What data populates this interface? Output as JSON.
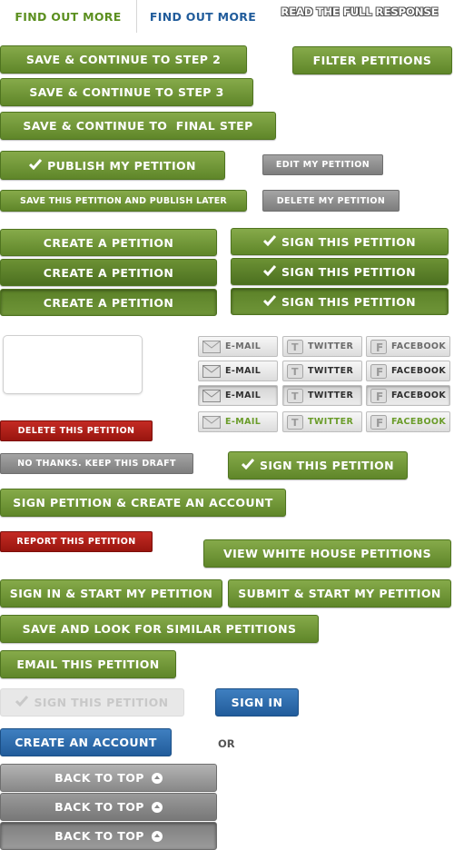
{
  "tabs": {
    "find_out_more_green": "FIND OUT MORE",
    "find_out_more_blue": "FIND OUT MORE",
    "read_full_response": "READ THE FULL RESPONSE"
  },
  "buttons": {
    "save_step2": "SAVE & CONTINUE TO STEP 2",
    "filter_petitions": "FILTER PETITIONS",
    "save_step3": "SAVE & CONTINUE TO STEP 3",
    "save_final": "SAVE & CONTINUE TO  FINAL STEP",
    "publish": "PUBLISH MY PETITION",
    "edit_petition": "EDIT MY PETITION",
    "save_publish_later": "SAVE THIS PETITION AND PUBLISH LATER",
    "delete_my_petition": "DELETE MY PETITION",
    "create_petition": "CREATE A PETITION",
    "sign_petition": "SIGN THIS PETITION",
    "delete_this_petition": "DELETE THIS PETITION",
    "no_thanks_draft": "NO THANKS. KEEP THIS DRAFT",
    "sign_and_create_account": "SIGN PETITION & CREATE AN ACCOUNT",
    "report_petition": "REPORT THIS PETITION",
    "view_white_house": "VIEW WHITE HOUSE PETITIONS",
    "sign_in_start": "SIGN IN & START MY PETITION",
    "submit_start": "SUBMIT & START MY PETITION",
    "save_look_similar": "SAVE AND LOOK FOR SIMILAR PETITIONS",
    "email_petition": "EMAIL THIS PETITION",
    "sign_disabled": "SIGN THIS PETITION",
    "sign_in": "SIGN IN",
    "create_account": "CREATE AN ACCOUNT",
    "or_label": "OR",
    "back_to_top": "BACK TO TOP"
  },
  "share": {
    "email": "E-MAIL",
    "twitter": "TWITTER",
    "facebook": "FACEBOOK"
  },
  "colors": {
    "green": "#6f9538",
    "gray": "#8c8c8c",
    "red": "#a81c16",
    "blue": "#2b6aab",
    "tab_green": "#5b8f1f",
    "tab_blue": "#215c9b"
  }
}
